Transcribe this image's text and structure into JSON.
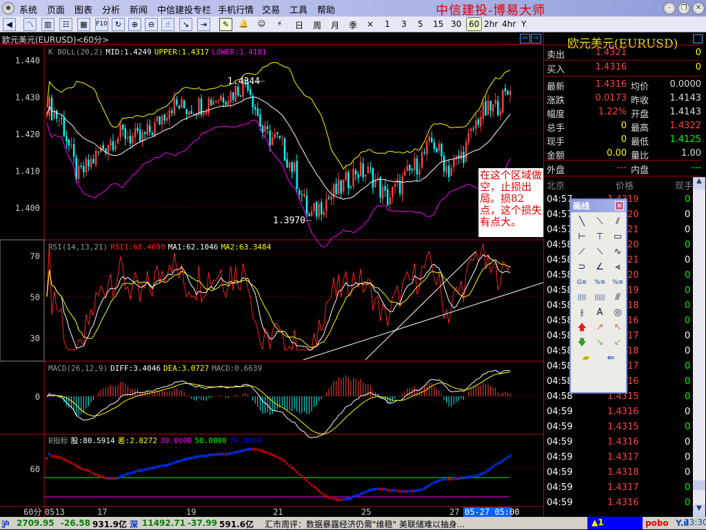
{
  "menu": [
    "系统",
    "页面",
    "图表",
    "分析",
    "新闻",
    "中信建投专栏",
    "手机行情",
    "交易",
    "工具",
    "帮助"
  ],
  "app_title": "中信建投-博易大师",
  "toolbar_icons": [
    "back-icon",
    "line-chart-icon",
    "candle-chart-icon",
    "list-icon",
    "quote-table-icon",
    "f10-icon",
    "refresh-icon",
    "zoom-in-icon",
    "zoom-out-icon",
    "select-cursor-icon",
    "window-arrow-icon",
    "export-icon",
    "draw-line-icon",
    "alarm-bell-icon",
    "users-icon",
    "lightning-icon"
  ],
  "f10_label": "F10",
  "periods": [
    "日",
    "周",
    "月",
    "季",
    "×",
    "1",
    "3",
    "5",
    "15",
    "30",
    "60",
    "2hr",
    "4hr",
    "Y"
  ],
  "selected_period": "60",
  "chart_title": "欧元美元(EURUSD)<60分>",
  "colors": {
    "up": "#ff4040",
    "down": "#00ffff",
    "mid": "#ffffff",
    "upper": "#ffff00",
    "lower": "#ff00ff",
    "grid": "#a00000"
  },
  "chart_data": [
    {
      "type": "candlestick",
      "panel": "price",
      "legend": {
        "name": "K  BOLL(20,2)",
        "mid": "MID:1.4249",
        "upper": "UPPER:1.4317",
        "lower": "LOWER:1.4181"
      },
      "yticks": [
        "1.440",
        "1.430",
        "1.420",
        "1.410",
        "1.400"
      ],
      "ylim": [
        1.392,
        1.444
      ],
      "close_path": [
        1.428,
        1.423,
        1.408,
        1.413,
        1.418,
        1.42,
        1.418,
        1.422,
        1.428,
        1.427,
        1.428,
        1.43,
        1.431,
        1.4344,
        1.42,
        1.418,
        1.41,
        1.397,
        1.402,
        1.405,
        1.41,
        1.409,
        1.402,
        1.407,
        1.412,
        1.418,
        1.41,
        1.415,
        1.425,
        1.427,
        1.4316
      ],
      "annotations": [
        "1.4344",
        "1.3970"
      ]
    },
    {
      "type": "line",
      "panel": "rsi",
      "legend": {
        "name": "RSI(14,13,21)",
        "rsi1": "RSI1:68.4690",
        "ma1": "MA1:62.1046",
        "ma2": "MA2:63.3484"
      },
      "yticks": [
        "70",
        "50",
        "30"
      ],
      "ylim": [
        20,
        78
      ]
    },
    {
      "type": "bar",
      "panel": "macd",
      "legend": {
        "name": "MACD(26,12,9)",
        "diff": "DIFF:3.4046",
        "dea": "DEA:3.0727",
        "macd": "MACD:0.6639"
      },
      "yticks": [
        "0"
      ]
    },
    {
      "type": "bar",
      "panel": "b-indicator",
      "legend": {
        "name": "B指标",
        "gu": "股:80.5914",
        "cha": "差:2.8272",
        "l30": "30.0000",
        "l50": "50.0000",
        "l70": "70.0000"
      },
      "yticks": [
        "60"
      ]
    }
  ],
  "xaxis": {
    "period": "60分",
    "ticks": [
      "0513",
      "17",
      "19",
      "21",
      "25",
      "27"
    ],
    "cursor": "05-27  05:00"
  },
  "note": "在这个区域做空，止损出局。损82点，这个损失有点大。",
  "quote": {
    "title": "欧元美元(EURUSD)",
    "sell": {
      "label": "卖出",
      "price": "1.4321",
      "vol": "0"
    },
    "buy": {
      "label": "买入",
      "price": "1.4316",
      "vol": "0"
    },
    "rows": [
      [
        "最新",
        "1.4316",
        "均价",
        "0.0000"
      ],
      [
        "涨跌",
        "0.0173",
        "昨收",
        "1.4143"
      ],
      [
        "幅度",
        "1.22%",
        "开盘",
        "1.4143"
      ],
      [
        "总手",
        "0",
        "最高",
        "1.4322"
      ],
      [
        "现手",
        "0",
        "最低",
        "1.4125"
      ],
      [
        "金额",
        "0.00",
        "量比",
        "1.00"
      ]
    ],
    "outer": {
      "label": "外盘",
      "val": "---"
    },
    "inner": {
      "label": "内盘",
      "val": "---"
    },
    "tick_headers": [
      "北京",
      "价格",
      "现手"
    ],
    "ticks": [
      [
        "04:57",
        "1.4319",
        "0",
        "g"
      ],
      [
        "04:57",
        "1.4320",
        "0",
        "w"
      ],
      [
        "04:57",
        "1.4321",
        "0",
        "w"
      ],
      [
        "04:58",
        "1.4320",
        "0",
        "g"
      ],
      [
        "04:58",
        "1.4321",
        "0",
        "w"
      ],
      [
        "04:58",
        "1.4320",
        "0",
        "g"
      ],
      [
        "04:58",
        "1.4319",
        "0",
        "g"
      ],
      [
        "04:58",
        "1.4318",
        "0",
        "g"
      ],
      [
        "04:58",
        "1.4316",
        "0",
        "g"
      ],
      [
        "04:58",
        "1.4317",
        "0",
        "w"
      ],
      [
        "04:58",
        "1.4318",
        "0",
        "w"
      ],
      [
        "04:58",
        "1.4317",
        "0",
        "g"
      ],
      [
        "04:58",
        "1.4316",
        "0",
        "g"
      ],
      [
        "04:58",
        "1.4315",
        "0",
        "g"
      ],
      [
        "04:59",
        "1.4316",
        "0",
        "w"
      ],
      [
        "04:59",
        "1.4315",
        "0",
        "g"
      ],
      [
        "04:59",
        "1.4316",
        "0",
        "w"
      ],
      [
        "04:59",
        "1.4317",
        "0",
        "w"
      ],
      [
        "04:59",
        "1.4318",
        "0",
        "w"
      ],
      [
        "04:59",
        "1.4317",
        "0",
        "g"
      ],
      [
        "04:59",
        "1.4316",
        "0",
        "g"
      ]
    ]
  },
  "toolbox": {
    "title": "画线",
    "tools": [
      "line-icon",
      "segment-icon",
      "parallel-lines-icon",
      "horizontal-line-icon",
      "vertical-line-icon",
      "rectangle-icon",
      "ray-up-icon",
      "ray-down-icon",
      "sine-wave-icon",
      "arc-icon",
      "angle-icon",
      "fan-lines-icon",
      "golden-ratio-icon",
      "percent-lines-icon",
      "percent-lines-2-icon",
      "period-lines-icon",
      "fibonacci-period-icon",
      "gann-fan-icon",
      "speed-lines-icon",
      "text-icon",
      "gann-circle-icon",
      "arrow-up-icon",
      "arrow-up-right-icon",
      "arrow-up-left-icon",
      "arrow-down-icon",
      "arrow-down-right-icon",
      "arrow-down-left-icon",
      "eraser-icon",
      "delete-all-icon"
    ],
    "text_tool": "A"
  },
  "status": {
    "sh_label": "沪",
    "sh_index": "2709.95",
    "sh_change": "-26.58",
    "sh_amount": "931.9亿",
    "sz_label": "深",
    "sz_index": "11492.71",
    "sz_change": "-37.99",
    "sz_amount": "591.6亿",
    "news": "汇市周评：数据暴露经济仍需\"维稳\" 美联储难以抽身...",
    "alert": "▲1",
    "brand": "pobo",
    "time": "13:30"
  }
}
